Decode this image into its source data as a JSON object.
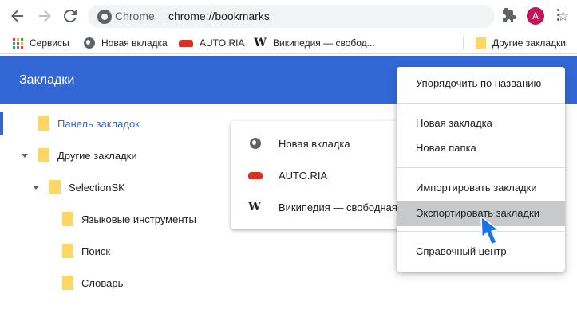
{
  "toolbar": {
    "omnibox_site": "Chrome",
    "omnibox_url": "chrome://bookmarks",
    "avatar_letter": "A"
  },
  "bookmarks_bar": {
    "items": [
      {
        "label": "Сервисы",
        "icon": "apps-icon"
      },
      {
        "label": "Новая вкладка",
        "icon": "globe-icon"
      },
      {
        "label": "AUTO.RIA",
        "icon": "car-icon"
      },
      {
        "label": "Википедия — свобод...",
        "icon": "wikipedia-icon"
      },
      {
        "label": "Другие закладки",
        "icon": "folder-icon"
      }
    ]
  },
  "header": {
    "title": "Закладки"
  },
  "sidebar": {
    "items": [
      {
        "label": "Панель закладок"
      },
      {
        "label": "Другие закладки"
      },
      {
        "label": "SelectionSK"
      },
      {
        "label": "Языковые инструменты"
      },
      {
        "label": "Поиск"
      },
      {
        "label": "Словарь"
      }
    ]
  },
  "list": {
    "items": [
      {
        "label": "Новая вкладка",
        "icon": "globe-icon"
      },
      {
        "label": "AUTO.RIA",
        "icon": "car-icon"
      },
      {
        "label": "Википедия — свободная",
        "icon": "wikipedia-icon"
      }
    ]
  },
  "menu": {
    "sort": "Упорядочить по названию",
    "new_bookmark": "Новая закладка",
    "new_folder": "Новая папка",
    "import": "Импортировать закладки",
    "export": "Экспортировать закладки",
    "help": "Справочный центр"
  },
  "colors": {
    "header": "#3367d6",
    "menu_hover": "#c7c9cb",
    "folder": "#fdd663",
    "cursor": "#1a73e8"
  }
}
